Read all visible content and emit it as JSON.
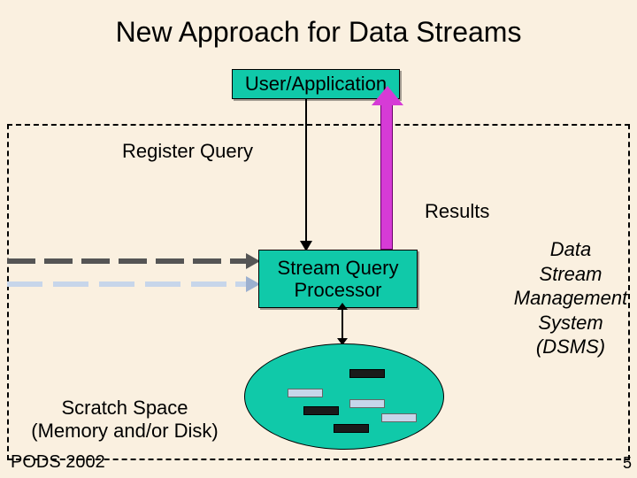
{
  "title": "New Approach for Data Streams",
  "user_app_box": "User/Application",
  "register_query_label": "Register Query",
  "results_label": "Results",
  "sqp_line1": "Stream Query",
  "sqp_line2": "Processor",
  "scratch_line1": "Scratch Space",
  "scratch_line2": "(Memory and/or Disk)",
  "dsms_line1": "Data",
  "dsms_line2": "Stream",
  "dsms_line3": "Management",
  "dsms_line4": "System",
  "dsms_line5": "(DSMS)",
  "footer": "PODS 2002",
  "page_number": "5",
  "colors": {
    "bg": "#faf0e0",
    "box": "#10c9a9",
    "results_arrow": "#d63bd6"
  }
}
